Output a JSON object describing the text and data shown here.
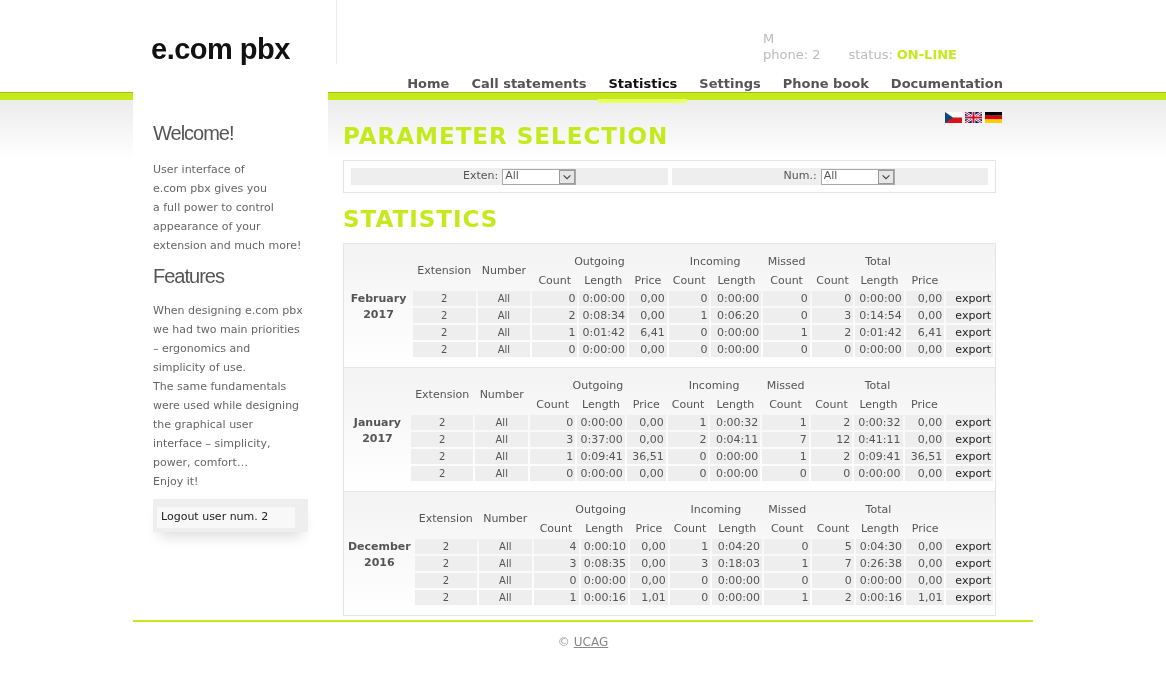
{
  "header": {
    "logo": "e.com pbx",
    "user": "M",
    "phone": "phone: 2",
    "status_label": "status:",
    "status_value": "ON-LINE"
  },
  "nav": [
    {
      "label": "Home",
      "selected": false
    },
    {
      "label": "Call statements",
      "selected": false
    },
    {
      "label": "Statistics",
      "selected": true
    },
    {
      "label": "Settings",
      "selected": false
    },
    {
      "label": "Phone book",
      "selected": false
    },
    {
      "label": "Documentation",
      "selected": false
    }
  ],
  "sidebar": {
    "welcome_title": "Welcome!",
    "welcome_lines": [
      "User interface of",
      "e.com pbx gives you",
      "a full power to control",
      "appearance of your",
      "extension and much more!"
    ],
    "features_title": "Features",
    "features_lines": [
      "When designing e.com pbx",
      "we had two main priorities",
      "– ergonomics and",
      "simplicity of use.",
      "The same fundamentals",
      "were used while designing",
      "the graphical user",
      "interface – simplicity,",
      "power, comfort…",
      "Enjoy it!"
    ],
    "logout": "Logout user num. 2"
  },
  "parameter_title": "PARAMETER SELECTION",
  "filters": [
    {
      "label": "Exten:",
      "value": "All"
    },
    {
      "label": "Num.:",
      "value": "All"
    }
  ],
  "statistics_title": "STATISTICS",
  "sections": [
    {
      "period": [
        "February",
        "2017"
      ],
      "group_headers": [
        "Extension",
        "Number",
        "Outgoing",
        "Incoming",
        "Missed",
        "Total"
      ],
      "columns": [
        "",
        "",
        "Count",
        "Length",
        "Price",
        "Count",
        "Length",
        "Count",
        "Count",
        "Length",
        "Price"
      ],
      "rows": [
        [
          "2",
          "All",
          "0",
          "0:00:00",
          "0,00",
          "0",
          "0:00:00",
          "0",
          "0",
          "0:00:00",
          "0,00",
          "export"
        ],
        [
          "2",
          "All",
          "2",
          "0:08:34",
          "0,00",
          "1",
          "0:06:20",
          "0",
          "3",
          "0:14:54",
          "0,00",
          "export"
        ],
        [
          "2",
          "All",
          "1",
          "0:01:42",
          "6,41",
          "0",
          "0:00:00",
          "1",
          "2",
          "0:01:42",
          "6,41",
          "export"
        ],
        [
          "2",
          "All",
          "0",
          "0:00:00",
          "0,00",
          "0",
          "0:00:00",
          "0",
          "0",
          "0:00:00",
          "0,00",
          "export"
        ]
      ]
    },
    {
      "period": [
        "January",
        "2017"
      ],
      "group_headers": [
        "Extension",
        "Number",
        "Outgoing",
        "Incoming",
        "Missed",
        "Total"
      ],
      "columns": [
        "",
        "",
        "Count",
        "Length",
        "Price",
        "Count",
        "Length",
        "Count",
        "Count",
        "Length",
        "Price"
      ],
      "rows": [
        [
          "2",
          "All",
          "0",
          "0:00:00",
          "0,00",
          "1",
          "0:00:32",
          "1",
          "2",
          "0:00:32",
          "0,00",
          "export"
        ],
        [
          "2",
          "All",
          "3",
          "0:37:00",
          "0,00",
          "2",
          "0:04:11",
          "7",
          "12",
          "0:41:11",
          "0,00",
          "export"
        ],
        [
          "2",
          "All",
          "1",
          "0:09:41",
          "36,51",
          "0",
          "0:00:00",
          "1",
          "2",
          "0:09:41",
          "36,51",
          "export"
        ],
        [
          "2",
          "All",
          "0",
          "0:00:00",
          "0,00",
          "0",
          "0:00:00",
          "0",
          "0",
          "0:00:00",
          "0,00",
          "export"
        ]
      ]
    },
    {
      "period": [
        "December",
        "2016"
      ],
      "group_headers": [
        "Extension",
        "Number",
        "Outgoing",
        "Incoming",
        "Missed",
        "Total"
      ],
      "columns": [
        "",
        "",
        "Count",
        "Length",
        "Price",
        "Count",
        "Length",
        "Count",
        "Count",
        "Length",
        "Price"
      ],
      "rows": [
        [
          "2",
          "All",
          "4",
          "0:00:10",
          "0,00",
          "1",
          "0:04:20",
          "0",
          "5",
          "0:04:30",
          "0,00",
          "export"
        ],
        [
          "2",
          "All",
          "3",
          "0:08:35",
          "0,00",
          "3",
          "0:18:03",
          "1",
          "7",
          "0:26:38",
          "0,00",
          "export"
        ],
        [
          "2",
          "All",
          "0",
          "0:00:00",
          "0,00",
          "0",
          "0:00:00",
          "0",
          "0",
          "0:00:00",
          "0,00",
          "export"
        ],
        [
          "2",
          "All",
          "1",
          "0:00:16",
          "1,01",
          "0",
          "0:00:00",
          "1",
          "2",
          "0:00:16",
          "1,01",
          "export"
        ]
      ]
    }
  ],
  "footer": {
    "copyright": "©",
    "link": "UCAG"
  }
}
